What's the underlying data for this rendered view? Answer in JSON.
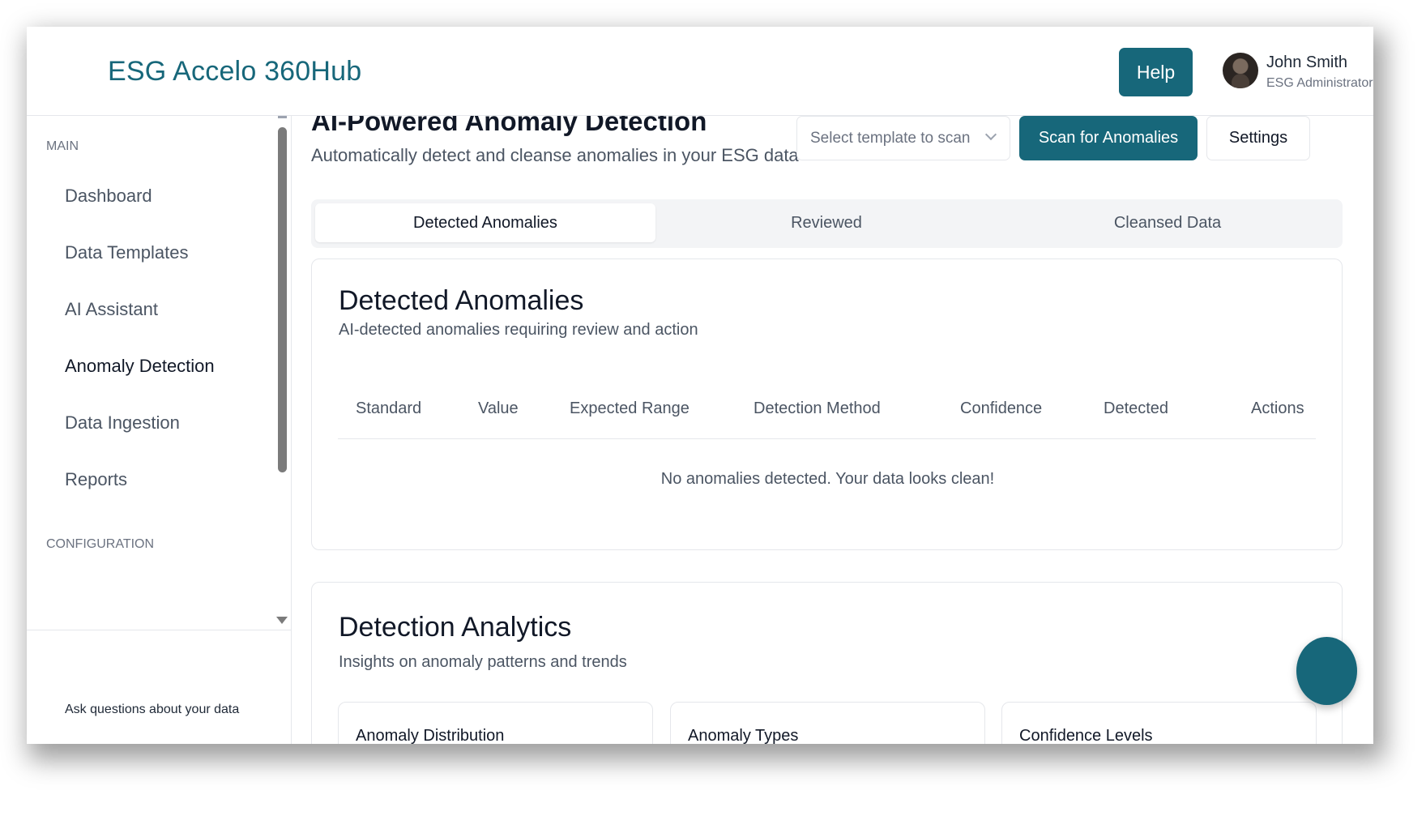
{
  "header": {
    "brand": "ESG Accelo 360Hub",
    "help_label": "Help",
    "user": {
      "name": "John Smith",
      "role": "ESG Administrator"
    }
  },
  "sidebar": {
    "section_main": "MAIN",
    "items": [
      {
        "label": "Dashboard"
      },
      {
        "label": "Data Templates"
      },
      {
        "label": "AI Assistant"
      },
      {
        "label": "Anomaly Detection"
      },
      {
        "label": "Data Ingestion"
      },
      {
        "label": "Reports"
      }
    ],
    "section_config": "CONFIGURATION",
    "footer_text": "Ask questions about your data"
  },
  "page": {
    "title": "AI-Powered Anomaly Detection",
    "subtitle": "Automatically detect and cleanse anomalies in your ESG data",
    "template_select_placeholder": "Select template to scan",
    "scan_label": "Scan for Anomalies",
    "settings_label": "Settings"
  },
  "tabs": [
    {
      "label": "Detected Anomalies"
    },
    {
      "label": "Reviewed"
    },
    {
      "label": "Cleansed Data"
    }
  ],
  "anomalies_card": {
    "title": "Detected Anomalies",
    "subtitle": "AI-detected anomalies requiring review and action",
    "columns": [
      "Standard",
      "Value",
      "Expected Range",
      "Detection Method",
      "Confidence",
      "Detected",
      "Actions"
    ],
    "empty_message": "No anomalies detected. Your data looks clean!"
  },
  "analytics_card": {
    "title": "Detection Analytics",
    "subtitle": "Insights on anomaly patterns and trends",
    "panels": [
      {
        "title": "Anomaly Distribution"
      },
      {
        "title": "Anomaly Types"
      },
      {
        "title": "Confidence Levels"
      }
    ]
  },
  "colors": {
    "accent": "#17677a",
    "border": "#e5e7eb",
    "muted_text": "#4b5563"
  }
}
